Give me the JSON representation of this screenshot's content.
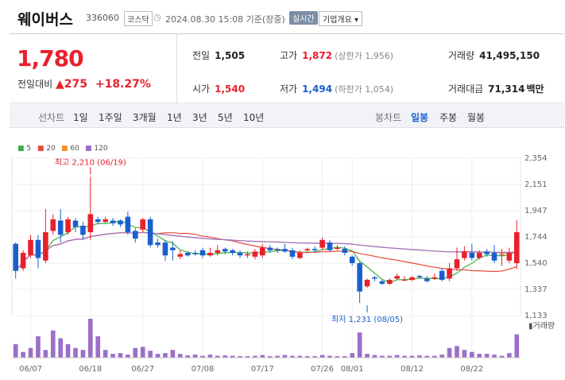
{
  "header": {
    "name": "웨이버스",
    "code": "336060",
    "market": "코스닥",
    "datetime": "2024.08.30 15:08 기준(장중)",
    "realtime_label": "실시간",
    "company_info_label": "기업개요 ▾"
  },
  "quote": {
    "price": "1,780",
    "change_label": "전일대비",
    "change": "275",
    "change_pct": "+18.27%",
    "prev_close_label": "전일",
    "prev_close": "1,505",
    "open_label": "시가",
    "open": "1,540",
    "high_label": "고가",
    "high": "1,872",
    "upper_limit": "(상한가 1,956)",
    "low_label": "저가",
    "low": "1,494",
    "lower_limit": "(하한가 1,054)",
    "volume_label": "거래량",
    "volume": "41,495,150",
    "amount_label": "거래대금",
    "amount": "71,314",
    "amount_unit": "백만"
  },
  "periods": {
    "line_label": "선차트",
    "line_items": [
      "1일",
      "1주일",
      "3개월",
      "1년",
      "3년",
      "5년",
      "10년"
    ],
    "candle_label": "봉차트",
    "candle_items": [
      "일봉",
      "주봉",
      "월봉"
    ],
    "selected": "일봉"
  },
  "colors": {
    "up": "#e8202c",
    "down": "#1a5fd0",
    "ma5": "#3cb043",
    "ma20": "#e84c3d",
    "ma60": "#f0922b",
    "ma120": "#9b6fc8",
    "volume": "#9b6fc8"
  },
  "chart_data": {
    "type": "candlestick",
    "legend": [
      "5",
      "20",
      "60",
      "120"
    ],
    "y_ticks": [
      "2,354",
      "2,151",
      "1,947",
      "1,744",
      "1,540",
      "1,337",
      "1,133"
    ],
    "ylim": [
      1133,
      2354
    ],
    "x_ticks": [
      "06/07",
      "06/18",
      "06/27",
      "07/08",
      "07/17",
      "07/26",
      "08/01",
      "08/12",
      "08/22"
    ],
    "x_tick_index": [
      2,
      10,
      17,
      25,
      33,
      41,
      45,
      53,
      61
    ],
    "high_annotation": "최고 2,210 (06/19)",
    "high_value": 2210,
    "high_index": 10,
    "low_annotation": "최저 1,231 (08/05)",
    "low_value": 1231,
    "low_index": 47,
    "volume_label": "거래량",
    "candles": [
      [
        1690,
        1480,
        1420,
        1700
      ],
      [
        1500,
        1620,
        1480,
        1640
      ],
      [
        1600,
        1720,
        1580,
        1760
      ],
      [
        1720,
        1580,
        1500,
        1760
      ],
      [
        1560,
        1780,
        1540,
        1960
      ],
      [
        1790,
        1880,
        1760,
        1920
      ],
      [
        1870,
        1760,
        1700,
        1960
      ],
      [
        1780,
        1880,
        1760,
        1900
      ],
      [
        1870,
        1820,
        1780,
        1890
      ],
      [
        1830,
        1760,
        1720,
        1860
      ],
      [
        1780,
        1920,
        1720,
        2210
      ],
      [
        1880,
        1860,
        1840,
        1900
      ],
      [
        1860,
        1880,
        1850,
        1900
      ],
      [
        1870,
        1850,
        1830,
        1890
      ],
      [
        1870,
        1840,
        1820,
        1880
      ],
      [
        1900,
        1780,
        1760,
        1940
      ],
      [
        1790,
        1730,
        1700,
        1810
      ],
      [
        1800,
        1880,
        1780,
        1890
      ],
      [
        1880,
        1680,
        1660,
        1900
      ],
      [
        1700,
        1680,
        1660,
        1730
      ],
      [
        1700,
        1600,
        1560,
        1720
      ],
      [
        1660,
        1640,
        1560,
        1710
      ],
      [
        1590,
        1610,
        1570,
        1640
      ],
      [
        1620,
        1600,
        1590,
        1630
      ],
      [
        1620,
        1610,
        1600,
        1640
      ],
      [
        1640,
        1600,
        1580,
        1660
      ],
      [
        1600,
        1620,
        1590,
        1660
      ],
      [
        1620,
        1640,
        1600,
        1680
      ],
      [
        1650,
        1630,
        1610,
        1660
      ],
      [
        1640,
        1620,
        1600,
        1650
      ],
      [
        1620,
        1600,
        1580,
        1640
      ],
      [
        1600,
        1610,
        1580,
        1630
      ],
      [
        1590,
        1630,
        1570,
        1650
      ],
      [
        1600,
        1660,
        1580,
        1690
      ],
      [
        1660,
        1640,
        1620,
        1680
      ],
      [
        1650,
        1640,
        1620,
        1660
      ],
      [
        1650,
        1630,
        1620,
        1690
      ],
      [
        1640,
        1590,
        1570,
        1660
      ],
      [
        1580,
        1620,
        1570,
        1640
      ],
      [
        1640,
        1650,
        1630,
        1660
      ],
      [
        1650,
        1640,
        1620,
        1670
      ],
      [
        1660,
        1720,
        1640,
        1740
      ],
      [
        1700,
        1640,
        1630,
        1720
      ],
      [
        1650,
        1660,
        1640,
        1680
      ],
      [
        1650,
        1620,
        1600,
        1670
      ],
      [
        1590,
        1540,
        1520,
        1600
      ],
      [
        1540,
        1320,
        1231,
        1550
      ],
      [
        1360,
        1410,
        1350,
        1420
      ],
      [
        1430,
        1420,
        1400,
        1440
      ],
      [
        1400,
        1380,
        1370,
        1410
      ],
      [
        1380,
        1410,
        1370,
        1420
      ],
      [
        1420,
        1440,
        1410,
        1460
      ],
      [
        1410,
        1410,
        1400,
        1440
      ],
      [
        1410,
        1430,
        1400,
        1440
      ],
      [
        1440,
        1430,
        1420,
        1450
      ],
      [
        1420,
        1400,
        1390,
        1440
      ],
      [
        1420,
        1430,
        1410,
        1460
      ],
      [
        1480,
        1410,
        1400,
        1500
      ],
      [
        1420,
        1500,
        1400,
        1540
      ],
      [
        1500,
        1570,
        1480,
        1660
      ],
      [
        1580,
        1630,
        1560,
        1670
      ],
      [
        1620,
        1580,
        1560,
        1690
      ],
      [
        1580,
        1620,
        1570,
        1640
      ],
      [
        1630,
        1610,
        1590,
        1650
      ],
      [
        1620,
        1560,
        1540,
        1680
      ],
      [
        1610,
        1610,
        1520,
        1650
      ],
      [
        1560,
        1620,
        1540,
        1660
      ],
      [
        1540,
        1780,
        1494,
        1872
      ]
    ],
    "volumes": [
      0.35,
      0.15,
      0.25,
      0.55,
      0.2,
      0.7,
      0.5,
      0.35,
      0.25,
      0.2,
      1.0,
      0.55,
      0.2,
      0.1,
      0.12,
      0.08,
      0.25,
      0.28,
      0.18,
      0.1,
      0.12,
      0.2,
      0.1,
      0.06,
      0.08,
      0.05,
      0.08,
      0.05,
      0.06,
      0.05,
      0.04,
      0.04,
      0.05,
      0.07,
      0.04,
      0.05,
      0.07,
      0.05,
      0.05,
      0.04,
      0.04,
      0.07,
      0.05,
      0.04,
      0.04,
      0.12,
      0.65,
      0.1,
      0.07,
      0.05,
      0.05,
      0.07,
      0.05,
      0.05,
      0.06,
      0.05,
      0.05,
      0.08,
      0.25,
      0.3,
      0.2,
      0.15,
      0.1,
      0.1,
      0.08,
      0.05,
      0.12,
      0.6
    ]
  }
}
